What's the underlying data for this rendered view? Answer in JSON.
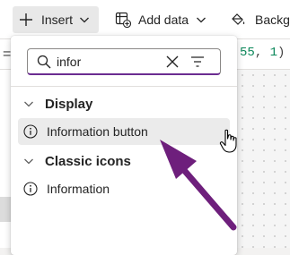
{
  "toolbar": {
    "insert_label": "Insert",
    "add_data_label": "Add data",
    "background_label": "Backgr"
  },
  "formula": {
    "prefix": "=",
    "number_a": "55",
    "comma": ", ",
    "number_b": "1",
    "close": ")"
  },
  "search": {
    "value": "infor"
  },
  "sections": [
    {
      "label": "Display",
      "items": [
        {
          "label": "Information button",
          "icon": "info-circle-icon"
        }
      ]
    },
    {
      "label": "Classic icons",
      "items": [
        {
          "label": "Information",
          "icon": "info-circle-icon"
        }
      ]
    }
  ],
  "colors": {
    "accent": "#6b2c91",
    "annotation_arrow": "#6e1f7c",
    "hover_background": "#ebebeb"
  }
}
